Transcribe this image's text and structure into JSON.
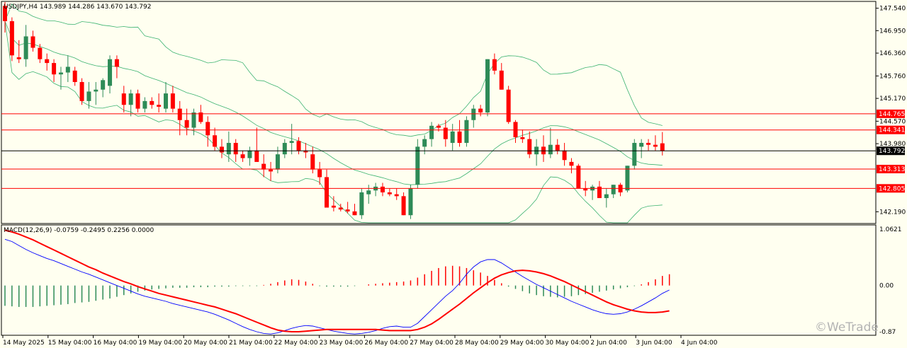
{
  "header": {
    "symbol": "USDJPY,H4",
    "ohlc": "143.989 144.286 143.670 143.792"
  },
  "watermark": "©WeTrade",
  "colors": {
    "background": "#fffff0",
    "bull": "#2e8b57",
    "bear": "#ff0000",
    "band": "#3cb371",
    "level": "#ff0000",
    "macd_line": "#0000ff",
    "signal_line": "#ff0000"
  },
  "chart_data": [
    {
      "type": "candlestick",
      "title": "USDJPY,H4",
      "ylim": [
        141.9,
        147.7
      ],
      "y_ticks": [
        "147.540",
        "146.950",
        "146.360",
        "145.760",
        "145.170",
        "144.570",
        "143.980",
        "142.190"
      ],
      "x_labels": [
        "14 May 2025",
        "15 May 04:00",
        "16 May 04:00",
        "19 May 04:00",
        "20 May 04:00",
        "21 May 04:00",
        "22 May 04:00",
        "23 May 04:00",
        "26 May 04:00",
        "27 May 04:00",
        "28 May 04:00",
        "29 May 04:00",
        "30 May 04:00",
        "2 Jun 04:00",
        "3 Jun 04:00",
        "4 Jun 04:00"
      ],
      "current_price": "143.792",
      "levels": [
        "144.765",
        "144.341",
        "143.313",
        "142.805"
      ],
      "ohlc": [
        [
          147.6,
          147.7,
          146.9,
          147.2
        ],
        [
          147.2,
          147.3,
          146.15,
          146.3
        ],
        [
          146.25,
          146.7,
          146.1,
          146.2
        ],
        [
          146.2,
          147.1,
          146.0,
          146.8
        ],
        [
          146.8,
          146.95,
          146.4,
          146.5
        ],
        [
          146.5,
          146.6,
          146.1,
          146.2
        ],
        [
          146.2,
          146.35,
          145.9,
          146.1
        ],
        [
          146.1,
          146.2,
          145.6,
          145.8
        ],
        [
          145.8,
          146.0,
          145.4,
          145.85
        ],
        [
          145.85,
          146.3,
          145.6,
          146.0
        ],
        [
          145.9,
          146.0,
          145.5,
          145.6
        ],
        [
          145.6,
          145.7,
          145.0,
          145.1
        ],
        [
          145.1,
          145.6,
          144.9,
          145.35
        ],
        [
          145.35,
          145.6,
          145.0,
          145.4
        ],
        [
          145.4,
          145.7,
          145.2,
          145.65
        ],
        [
          145.5,
          146.3,
          145.3,
          146.2
        ],
        [
          146.2,
          146.3,
          145.7,
          146.0
        ],
        [
          145.3,
          145.5,
          144.8,
          145.0
        ],
        [
          145.0,
          145.4,
          144.7,
          145.3
        ],
        [
          145.3,
          145.4,
          144.8,
          144.9
        ],
        [
          144.9,
          145.2,
          144.8,
          145.1
        ],
        [
          145.1,
          145.2,
          144.9,
          145.0
        ],
        [
          145.0,
          145.3,
          144.8,
          144.95
        ],
        [
          144.9,
          145.6,
          144.8,
          145.3
        ],
        [
          145.3,
          145.5,
          144.8,
          144.9
        ],
        [
          144.9,
          145.1,
          144.2,
          144.6
        ],
        [
          144.6,
          144.9,
          144.2,
          144.4
        ],
        [
          144.4,
          144.9,
          144.2,
          144.8
        ],
        [
          144.8,
          145.0,
          144.5,
          144.55
        ],
        [
          144.55,
          144.7,
          143.9,
          144.2
        ],
        [
          144.2,
          144.4,
          143.8,
          143.9
        ],
        [
          143.9,
          144.1,
          143.6,
          143.75
        ],
        [
          143.7,
          144.3,
          143.5,
          144.0
        ],
        [
          144.0,
          144.1,
          143.5,
          143.7
        ],
        [
          143.7,
          143.8,
          143.5,
          143.6
        ],
        [
          143.6,
          143.9,
          143.4,
          143.8
        ],
        [
          143.8,
          144.4,
          143.6,
          143.5
        ],
        [
          143.45,
          143.7,
          143.1,
          143.3
        ],
        [
          143.3,
          143.5,
          143.0,
          143.25
        ],
        [
          143.3,
          143.9,
          143.2,
          143.7
        ],
        [
          143.7,
          144.1,
          143.6,
          144.0
        ],
        [
          144.0,
          144.5,
          143.7,
          144.05
        ],
        [
          144.05,
          144.15,
          143.7,
          143.8
        ],
        [
          143.8,
          144.0,
          143.6,
          143.75
        ],
        [
          143.7,
          143.9,
          143.2,
          143.3
        ],
        [
          143.3,
          143.5,
          142.9,
          143.1
        ],
        [
          143.1,
          143.3,
          142.4,
          142.3
        ],
        [
          142.35,
          142.6,
          142.2,
          142.3
        ],
        [
          142.3,
          142.4,
          142.2,
          142.25
        ],
        [
          142.25,
          142.45,
          142.15,
          142.2
        ],
        [
          142.2,
          142.4,
          142.1,
          142.1
        ],
        [
          142.1,
          142.8,
          142.0,
          142.7
        ],
        [
          142.65,
          142.9,
          142.4,
          142.75
        ],
        [
          142.75,
          142.95,
          142.6,
          142.85
        ],
        [
          142.85,
          142.95,
          142.6,
          142.7
        ],
        [
          142.7,
          142.8,
          142.6,
          142.65
        ],
        [
          142.65,
          142.8,
          142.5,
          142.6
        ],
        [
          142.6,
          142.7,
          142.1,
          142.1
        ],
        [
          142.1,
          142.9,
          142.0,
          142.8
        ],
        [
          142.9,
          144.1,
          142.8,
          143.9
        ],
        [
          143.9,
          144.2,
          143.7,
          144.1
        ],
        [
          144.1,
          144.55,
          143.9,
          144.45
        ],
        [
          144.45,
          144.5,
          144.3,
          144.4
        ],
        [
          144.4,
          144.6,
          143.9,
          144.1
        ],
        [
          144.0,
          144.5,
          143.8,
          144.3
        ],
        [
          144.3,
          144.6,
          143.9,
          144.0
        ],
        [
          144.0,
          144.7,
          143.9,
          144.6
        ],
        [
          144.6,
          145.0,
          144.4,
          144.9
        ],
        [
          144.9,
          145.0,
          144.7,
          144.8
        ],
        [
          144.8,
          146.2,
          144.7,
          146.2
        ],
        [
          146.2,
          146.35,
          145.8,
          145.9
        ],
        [
          145.9,
          146.1,
          145.4,
          145.4
        ],
        [
          145.4,
          145.5,
          144.5,
          144.55
        ],
        [
          144.55,
          144.6,
          144.0,
          144.15
        ],
        [
          144.15,
          144.35,
          144.0,
          144.1
        ],
        [
          144.1,
          144.3,
          143.6,
          143.7
        ],
        [
          143.7,
          144.1,
          143.4,
          143.9
        ],
        [
          143.9,
          144.2,
          143.5,
          143.7
        ],
        [
          143.7,
          144.4,
          143.6,
          143.95
        ],
        [
          143.95,
          144.1,
          143.7,
          143.8
        ],
        [
          143.8,
          144.0,
          143.4,
          143.55
        ],
        [
          143.5,
          143.6,
          143.2,
          143.4
        ],
        [
          143.4,
          143.45,
          142.8,
          142.8
        ],
        [
          142.8,
          143.0,
          142.6,
          142.75
        ],
        [
          142.75,
          142.9,
          142.5,
          142.85
        ],
        [
          142.85,
          143.0,
          142.55,
          142.55
        ],
        [
          142.55,
          142.8,
          142.3,
          142.65
        ],
        [
          142.65,
          142.9,
          142.55,
          142.9
        ],
        [
          142.9,
          142.95,
          142.6,
          142.7
        ],
        [
          142.75,
          143.4,
          142.7,
          143.4
        ],
        [
          143.4,
          144.1,
          143.3,
          144.0
        ],
        [
          143.9,
          144.1,
          143.6,
          144.0
        ],
        [
          144.0,
          144.1,
          143.8,
          143.95
        ],
        [
          143.95,
          144.2,
          143.8,
          143.9
        ],
        [
          143.989,
          144.286,
          143.67,
          143.792
        ]
      ]
    },
    {
      "type": "bar",
      "title": "MACD(12,26,9) -0.0759 -0.2495 0.2256 0.0000",
      "ylim": [
        -0.87,
        1.0621
      ],
      "y_ticks": [
        "1.0621",
        "0.00",
        "-0.87"
      ],
      "histogram": [
        -0.36,
        -0.37,
        -0.38,
        -0.38,
        -0.38,
        -0.37,
        -0.36,
        -0.35,
        -0.34,
        -0.33,
        -0.31,
        -0.3,
        -0.29,
        -0.27,
        -0.25,
        -0.23,
        -0.2,
        -0.17,
        -0.14,
        -0.11,
        -0.09,
        -0.07,
        -0.06,
        -0.05,
        -0.04,
        -0.04,
        -0.04,
        -0.03,
        -0.03,
        -0.03,
        -0.02,
        -0.02,
        -0.02,
        -0.01,
        -0.01,
        -0.01,
        -0.01,
        0.01,
        0.03,
        0.06,
        0.09,
        0.11,
        0.1,
        0.07,
        0.03,
        -0.01,
        -0.02,
        -0.02,
        -0.02,
        -0.02,
        -0.01,
        0.0,
        0.02,
        0.03,
        0.04,
        0.05,
        0.06,
        0.07,
        0.09,
        0.14,
        0.2,
        0.26,
        0.31,
        0.34,
        0.35,
        0.34,
        0.31,
        0.27,
        0.23,
        0.17,
        0.1,
        0.04,
        -0.02,
        -0.06,
        -0.1,
        -0.14,
        -0.17,
        -0.19,
        -0.2,
        -0.21,
        -0.2,
        -0.19,
        -0.17,
        -0.15,
        -0.13,
        -0.11,
        -0.09,
        -0.07,
        -0.05,
        -0.03,
        -0.01,
        0.02,
        0.06,
        0.11,
        0.17,
        0.2
      ],
      "macd_line": [
        0.82,
        0.78,
        0.71,
        0.64,
        0.58,
        0.53,
        0.48,
        0.44,
        0.39,
        0.34,
        0.29,
        0.24,
        0.2,
        0.15,
        0.1,
        0.05,
        0.0,
        -0.05,
        -0.1,
        -0.15,
        -0.19,
        -0.22,
        -0.25,
        -0.28,
        -0.32,
        -0.35,
        -0.38,
        -0.41,
        -0.44,
        -0.47,
        -0.51,
        -0.56,
        -0.61,
        -0.67,
        -0.73,
        -0.78,
        -0.82,
        -0.85,
        -0.86,
        -0.84,
        -0.8,
        -0.76,
        -0.73,
        -0.71,
        -0.72,
        -0.75,
        -0.78,
        -0.81,
        -0.83,
        -0.85,
        -0.86,
        -0.85,
        -0.83,
        -0.8,
        -0.76,
        -0.73,
        -0.72,
        -0.74,
        -0.74,
        -0.67,
        -0.55,
        -0.43,
        -0.31,
        -0.19,
        -0.09,
        0.04,
        0.2,
        0.33,
        0.42,
        0.46,
        0.46,
        0.4,
        0.32,
        0.24,
        0.16,
        0.09,
        0.02,
        -0.04,
        -0.1,
        -0.16,
        -0.22,
        -0.28,
        -0.33,
        -0.38,
        -0.43,
        -0.47,
        -0.5,
        -0.51,
        -0.5,
        -0.47,
        -0.42,
        -0.36,
        -0.29,
        -0.22,
        -0.14,
        -0.08
      ],
      "signal_line": [
        0.98,
        0.95,
        0.91,
        0.86,
        0.81,
        0.75,
        0.69,
        0.63,
        0.57,
        0.51,
        0.45,
        0.39,
        0.33,
        0.28,
        0.22,
        0.17,
        0.12,
        0.07,
        0.03,
        -0.02,
        -0.06,
        -0.1,
        -0.14,
        -0.17,
        -0.2,
        -0.23,
        -0.26,
        -0.29,
        -0.32,
        -0.35,
        -0.38,
        -0.42,
        -0.46,
        -0.5,
        -0.55,
        -0.6,
        -0.65,
        -0.7,
        -0.75,
        -0.79,
        -0.81,
        -0.82,
        -0.82,
        -0.81,
        -0.8,
        -0.79,
        -0.78,
        -0.78,
        -0.78,
        -0.78,
        -0.78,
        -0.78,
        -0.78,
        -0.78,
        -0.79,
        -0.8,
        -0.8,
        -0.8,
        -0.8,
        -0.78,
        -0.74,
        -0.68,
        -0.6,
        -0.51,
        -0.42,
        -0.33,
        -0.23,
        -0.13,
        -0.04,
        0.05,
        0.13,
        0.19,
        0.23,
        0.26,
        0.27,
        0.26,
        0.24,
        0.21,
        0.17,
        0.12,
        0.07,
        0.01,
        -0.05,
        -0.11,
        -0.17,
        -0.23,
        -0.29,
        -0.34,
        -0.38,
        -0.42,
        -0.45,
        -0.47,
        -0.48,
        -0.48,
        -0.47,
        -0.45
      ]
    }
  ]
}
